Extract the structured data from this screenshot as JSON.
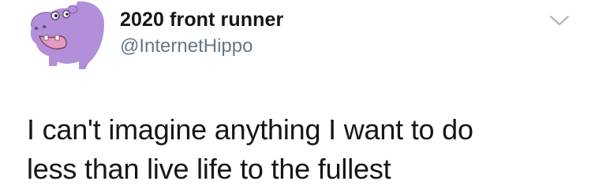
{
  "user": {
    "display_name": "2020 front runner",
    "handle": "@InternetHippo",
    "avatar_icon": "purple-hippo-avatar"
  },
  "tweet": {
    "text_lines": [
      "I can't imagine anything I want to do",
      "less than live life to the fullest"
    ]
  },
  "menu": {
    "icon": "chevron-down-icon"
  },
  "colors": {
    "text": "#14171a",
    "secondary_text": "#657786",
    "chevron": "#aab8c2",
    "hippo_purple": "#b48fd9",
    "hippo_mouth": "#e79ac2"
  }
}
